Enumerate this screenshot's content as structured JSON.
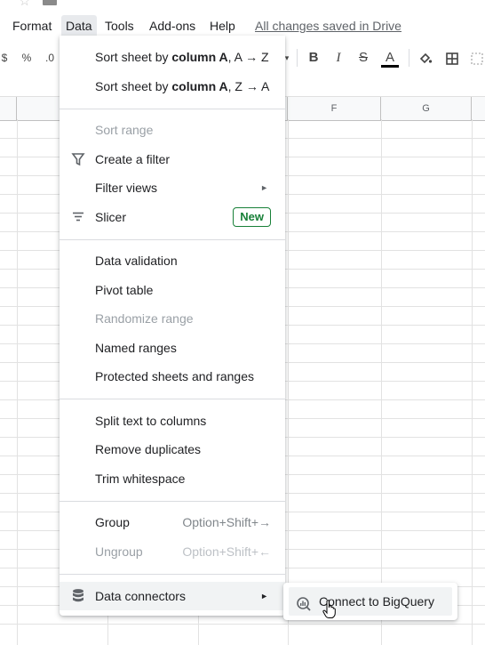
{
  "menubar": {
    "items": [
      "Format",
      "Data",
      "Tools",
      "Add-ons",
      "Help"
    ],
    "active_index": 1,
    "saved_status": "All changes saved in Drive"
  },
  "toolbar": {
    "currency": "$",
    "percent": "%",
    "decimal": ".0",
    "bold": "B",
    "italic": "I",
    "strike": "S",
    "text_color_letter": "A"
  },
  "columns": [
    "F",
    "G"
  ],
  "data_menu": {
    "sort_az_prefix": "Sort sheet by ",
    "sort_az_bold": "column A",
    "sort_az_suffix": ", A → Z",
    "sort_za_prefix": "Sort sheet by ",
    "sort_za_bold": "column A",
    "sort_za_suffix": ", Z → A",
    "sort_range": "Sort range",
    "create_filter": "Create a filter",
    "filter_views": "Filter views",
    "slicer": "Slicer",
    "slicer_badge": "New",
    "data_validation": "Data validation",
    "pivot_table": "Pivot table",
    "randomize_range": "Randomize range",
    "named_ranges": "Named ranges",
    "protected": "Protected sheets and ranges",
    "split_text": "Split text to columns",
    "remove_duplicates": "Remove duplicates",
    "trim_whitespace": "Trim whitespace",
    "group": "Group",
    "group_shortcut": "Option+Shift+→",
    "ungroup": "Ungroup",
    "ungroup_shortcut": "Option+Shift+←",
    "data_connectors": "Data connectors"
  },
  "submenu": {
    "connect_bigquery": "Connect to BigQuery"
  },
  "colors": {
    "accent_green": "#188038",
    "menu_hover": "#f1f3f4",
    "divider": "#dadce0"
  }
}
